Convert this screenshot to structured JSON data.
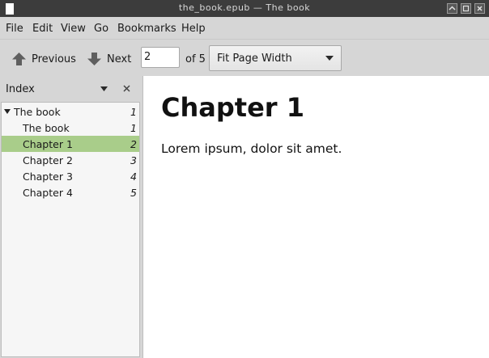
{
  "window": {
    "title": "the_book.epub — The book"
  },
  "menu": [
    "File",
    "Edit",
    "View",
    "Go",
    "Bookmarks",
    "Help"
  ],
  "toolbar": {
    "previous_label": "Previous",
    "next_label": "Next",
    "page_value": "2",
    "of_label": "of 5",
    "zoom_selected": "Fit Page Width"
  },
  "sidebar": {
    "title": "Index",
    "tree": [
      {
        "label": "The book",
        "page": "1",
        "expanded": true,
        "selected": false
      },
      {
        "label": "The book",
        "page": "1",
        "selected": false
      },
      {
        "label": "Chapter 1",
        "page": "2",
        "selected": true
      },
      {
        "label": "Chapter 2",
        "page": "3",
        "selected": false
      },
      {
        "label": "Chapter 3",
        "page": "4",
        "selected": false
      },
      {
        "label": "Chapter 4",
        "page": "5",
        "selected": false
      }
    ]
  },
  "document": {
    "heading": "Chapter 1",
    "body": "Lorem ipsum, dolor sit amet."
  },
  "colors": {
    "selection": "#a9cd8a",
    "titlebar": "#3c3c3c",
    "chrome": "#d6d6d6"
  },
  "icons": [
    "up-arrow-icon",
    "down-arrow-icon",
    "dropdown-arrow-icon",
    "close-icon",
    "expander-icon",
    "minimize-icon",
    "maximize-icon",
    "window-close-icon"
  ]
}
